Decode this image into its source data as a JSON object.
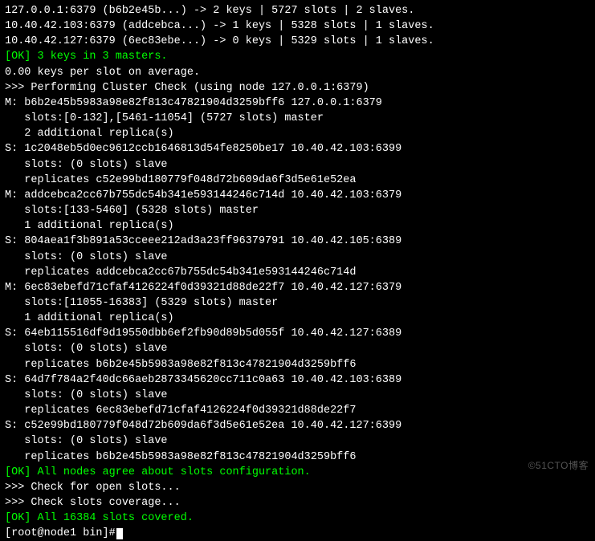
{
  "summary": {
    "l1": "127.0.0.1:6379 (b6b2e45b...) -> 2 keys | 5727 slots | 2 slaves.",
    "l2": "10.40.42.103:6379 (addcebca...) -> 1 keys | 5328 slots | 1 slaves.",
    "l3": "10.40.42.127:6379 (6ec83ebe...) -> 0 keys | 5329 slots | 1 slaves."
  },
  "ok_keys": "[OK] 3 keys in 3 masters.",
  "avg": "0.00 keys per slot on average.",
  "check_hdr": ">>> Performing Cluster Check (using node 127.0.0.1:6379)",
  "nodes": {
    "m1a": "M: b6b2e45b5983a98e82f813c47821904d3259bff6 127.0.0.1:6379",
    "m1b": "   slots:[0-132],[5461-11054] (5727 slots) master",
    "m1c": "   2 additional replica(s)",
    "s1a": "S: 1c2048eb5d0ec9612ccb1646813d54fe8250be17 10.40.42.103:6399",
    "s1b": "   slots: (0 slots) slave",
    "s1c": "   replicates c52e99bd180779f048d72b609da6f3d5e61e52ea",
    "m2a": "M: addcebca2cc67b755dc54b341e593144246c714d 10.40.42.103:6379",
    "m2b": "   slots:[133-5460] (5328 slots) master",
    "m2c": "   1 additional replica(s)",
    "s2a": "S: 804aea1f3b891a53cceee212ad3a23ff96379791 10.40.42.105:6389",
    "s2b": "   slots: (0 slots) slave",
    "s2c": "   replicates addcebca2cc67b755dc54b341e593144246c714d",
    "m3a": "M: 6ec83ebefd71cfaf4126224f0d39321d88de22f7 10.40.42.127:6379",
    "m3b": "   slots:[11055-16383] (5329 slots) master",
    "m3c": "   1 additional replica(s)",
    "s3a": "S: 64eb115516df9d19550dbb6ef2fb90d89b5d055f 10.40.42.127:6389",
    "s3b": "   slots: (0 slots) slave",
    "s3c": "   replicates b6b2e45b5983a98e82f813c47821904d3259bff6",
    "s4a": "S: 64d7f784a2f40dc66aeb2873345620cc711c0a63 10.40.42.103:6389",
    "s4b": "   slots: (0 slots) slave",
    "s4c": "   replicates 6ec83ebefd71cfaf4126224f0d39321d88de22f7",
    "s5a": "S: c52e99bd180779f048d72b609da6f3d5e61e52ea 10.40.42.127:6399",
    "s5b": "   slots: (0 slots) slave",
    "s5c": "   replicates b6b2e45b5983a98e82f813c47821904d3259bff6"
  },
  "ok_agree": "[OK] All nodes agree about slots configuration.",
  "check_open": ">>> Check for open slots...",
  "check_cov": ">>> Check slots coverage...",
  "ok_cov": "[OK] All 16384 slots covered.",
  "prompt": "[root@node1 bin]#",
  "watermark": "©51CTO博客"
}
